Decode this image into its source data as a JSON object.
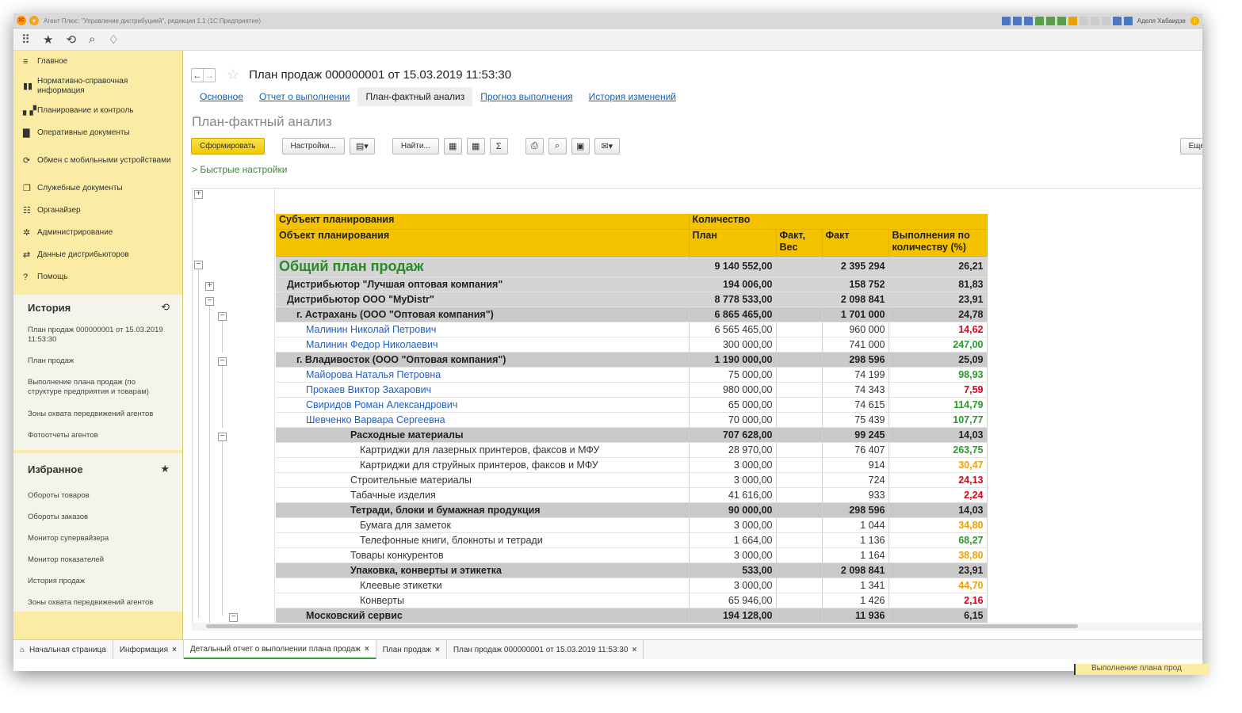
{
  "window": {
    "title": "Агент Плюс: \"Управление дистрибуцией\", редакция 1.1  (1С:Предприятие)",
    "user": "Аделя Хабаидзе",
    "logo": "1С"
  },
  "sidebar": {
    "items": [
      {
        "label": "Главное",
        "icon": "menu-icon",
        "glyph": "≡"
      },
      {
        "label": "Нормативно-справочная информация",
        "icon": "reference-icon",
        "glyph": "▮▮"
      },
      {
        "label": "Планирование и контроль",
        "icon": "chart-icon",
        "glyph": "▖▞"
      },
      {
        "label": "Оперативные документы",
        "icon": "documents-icon",
        "glyph": "▇"
      },
      {
        "label": "Обмен с мобильными устройствами",
        "icon": "sync-icon",
        "glyph": "⟳"
      },
      {
        "label": "Служебные документы",
        "icon": "service-docs-icon",
        "glyph": "❐"
      },
      {
        "label": "Органайзер",
        "icon": "organizer-icon",
        "glyph": "☷"
      },
      {
        "label": "Администрирование",
        "icon": "gear-icon",
        "glyph": "✲"
      },
      {
        "label": "Данные дистрибьюторов",
        "icon": "distributor-icon",
        "glyph": "⇄"
      },
      {
        "label": "Помощь",
        "icon": "help-icon",
        "glyph": "?"
      }
    ],
    "history": {
      "title": "История",
      "links": [
        "План продаж 000000001 от 15.03.2019 11:53:30",
        "План продаж",
        "Выполнение плана продаж (по структуре предприятия и товарам)",
        "Зоны охвата передвижений агентов",
        "Фотоотчеты агентов"
      ]
    },
    "favorites": {
      "title": "Избранное",
      "links": [
        "Обороты товаров",
        "Обороты заказов",
        "Монитор супервайзера",
        "Монитор показателей",
        "История продаж",
        "Зоны охвата передвижений агентов"
      ]
    }
  },
  "doc": {
    "title": "План продаж 000000001 от 15.03.2019 11:53:30",
    "tabs": [
      "Основное",
      "Отчет о выполнении",
      "План-фактный анализ",
      "Прогноз выполнения",
      "История изменений"
    ],
    "section_title": "План-фактный анализ",
    "toolbar": {
      "generate": "Сформировать",
      "settings": "Настройки...",
      "find": "Найти...",
      "more": "Еще",
      "sum": "Σ"
    },
    "quick_settings": "> Быстрые настройки"
  },
  "report": {
    "header": {
      "subject": "Субъект планирования",
      "object": "Объект планирования",
      "qty": "Количество",
      "plan": "План",
      "fact_weight": "Факт, Вес",
      "fact": "Факт",
      "exec": "Выполнения по количеству (%)"
    },
    "rows": [
      {
        "name": "Общий план продаж",
        "plan": "9 140 552,00",
        "fw": "",
        "fact": "2 395 294",
        "pct": "26,21",
        "pc": "red",
        "style": "top",
        "indent": 0
      },
      {
        "name": "Дистрибьютор \"Лучшая оптовая компания\"",
        "plan": "194 006,00",
        "fw": "",
        "fact": "158 752",
        "pct": "81,83",
        "pc": "green",
        "style": "g1",
        "indent": 10
      },
      {
        "name": "Дистрибьютор ООО \"MyDistr\"",
        "plan": "8 778 533,00",
        "fw": "",
        "fact": "2 098 841",
        "pct": "23,91",
        "pc": "red",
        "style": "g1",
        "indent": 10
      },
      {
        "name": "г. Астрахань (ООО \"Оптовая компания\")",
        "plan": "6 865 465,00",
        "fw": "",
        "fact": "1 701 000",
        "pct": "24,78",
        "pc": "red",
        "style": "g2",
        "indent": 22
      },
      {
        "name": "Малинин Николай Петрович",
        "plan": "6 565 465,00",
        "fw": "",
        "fact": "960 000",
        "pct": "14,62",
        "pc": "red",
        "style": "link",
        "indent": 34
      },
      {
        "name": "Малинин Федор Николаевич",
        "plan": "300 000,00",
        "fw": "",
        "fact": "741 000",
        "pct": "247,00",
        "pc": "green",
        "style": "link",
        "indent": 34
      },
      {
        "name": "г. Владивосток (ООО \"Оптовая компания\")",
        "plan": "1 190 000,00",
        "fw": "",
        "fact": "298 596",
        "pct": "25,09",
        "pc": "red",
        "style": "g2",
        "indent": 22
      },
      {
        "name": "Майорова Наталья Петровна",
        "plan": "75 000,00",
        "fw": "",
        "fact": "74 199",
        "pct": "98,93",
        "pc": "green",
        "style": "link",
        "indent": 34
      },
      {
        "name": "Прокаев Виктор Захарович",
        "plan": "980 000,00",
        "fw": "",
        "fact": "74 343",
        "pct": "7,59",
        "pc": "red",
        "style": "link",
        "indent": 34
      },
      {
        "name": "Свиридов Роман Александрович",
        "plan": "65 000,00",
        "fw": "",
        "fact": "74 615",
        "pct": "114,79",
        "pc": "green",
        "style": "link",
        "indent": 34
      },
      {
        "name": "Шевченко Варвара Сергеевна",
        "plan": "70 000,00",
        "fw": "",
        "fact": "75 439",
        "pct": "107,77",
        "pc": "green",
        "style": "link",
        "indent": 34
      },
      {
        "name": "Расходные материалы",
        "plan": "707 628,00",
        "fw": "",
        "fact": "99 245",
        "pct": "14,03",
        "pc": "red",
        "style": "g2",
        "indent": 90
      },
      {
        "name": "Картриджи для лазерных принтеров, факсов и МФУ",
        "plan": "28 970,00",
        "fw": "",
        "fact": "76 407",
        "pct": "263,75",
        "pc": "green",
        "style": "plain",
        "indent": 102
      },
      {
        "name": "Картриджи для струйных принтеров, факсов и МФУ",
        "plan": "3 000,00",
        "fw": "",
        "fact": "914",
        "pct": "30,47",
        "pc": "orange",
        "style": "plain",
        "indent": 102
      },
      {
        "name": "Строительные материалы",
        "plan": "3 000,00",
        "fw": "",
        "fact": "724",
        "pct": "24,13",
        "pc": "red",
        "style": "plain",
        "indent": 90
      },
      {
        "name": "Табачные изделия",
        "plan": "41 616,00",
        "fw": "",
        "fact": "933",
        "pct": "2,24",
        "pc": "red",
        "style": "plain",
        "indent": 90
      },
      {
        "name": "Тетради, блоки и бумажная продукция",
        "plan": "90 000,00",
        "fw": "",
        "fact": "298 596",
        "pct": "14,03",
        "pc": "red",
        "style": "g2",
        "indent": 90
      },
      {
        "name": "Бумага для заметок",
        "plan": "3 000,00",
        "fw": "",
        "fact": "1 044",
        "pct": "34,80",
        "pc": "orange",
        "style": "plain",
        "indent": 102
      },
      {
        "name": "Телефонные книги, блокноты и тетради",
        "plan": "1 664,00",
        "fw": "",
        "fact": "1 136",
        "pct": "68,27",
        "pc": "green",
        "style": "plain",
        "indent": 102
      },
      {
        "name": "Товары конкурентов",
        "plan": "3 000,00",
        "fw": "",
        "fact": "1 164",
        "pct": "38,80",
        "pc": "orange",
        "style": "plain",
        "indent": 90
      },
      {
        "name": "Упаковка, конверты и этикетка",
        "plan": "533,00",
        "fw": "",
        "fact": "2 098 841",
        "pct": "23,91",
        "pc": "red",
        "style": "g2",
        "indent": 90
      },
      {
        "name": "Клеевые этикетки",
        "plan": "3 000,00",
        "fw": "",
        "fact": "1 341",
        "pct": "44,70",
        "pc": "orange",
        "style": "plain",
        "indent": 102
      },
      {
        "name": "Конверты",
        "plan": "65 946,00",
        "fw": "",
        "fact": "1 426",
        "pct": "2,16",
        "pc": "red",
        "style": "plain",
        "indent": 102
      },
      {
        "name": "Московский сервис",
        "plan": "194 128,00",
        "fw": "",
        "fact": "11 936",
        "pct": "6,15",
        "pc": "red",
        "style": "g2",
        "indent": 34
      }
    ]
  },
  "bottom_tabs": [
    {
      "label": "Начальная страница",
      "closable": false
    },
    {
      "label": "Информация",
      "closable": true
    },
    {
      "label": "Детальный отчет о выполнении плана продаж",
      "closable": true,
      "active": true
    },
    {
      "label": "План продаж",
      "closable": true
    },
    {
      "label": "План продаж 000000001 от 15.03.2019 11:53:30",
      "closable": true
    }
  ],
  "peek_text": "Выполнение плана прод",
  "colors": {
    "sidebar": "#fbeca5",
    "header": "#f5c200",
    "red": "#e0001a",
    "green": "#2a9a2a",
    "orange": "#f0a000"
  }
}
